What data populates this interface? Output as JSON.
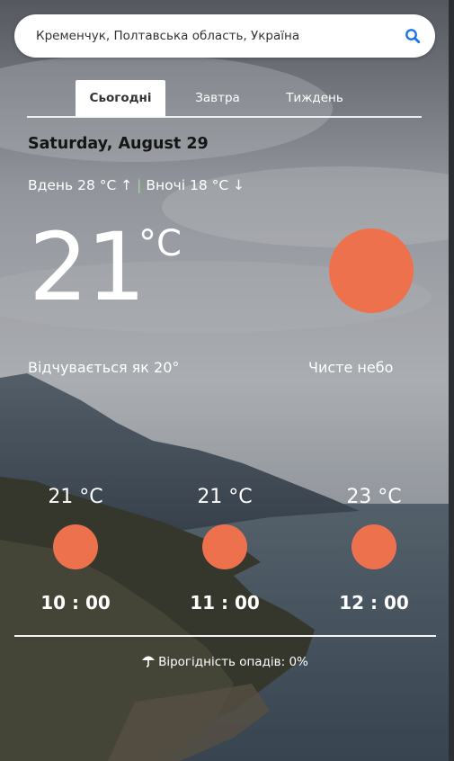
{
  "search": {
    "value": "Кременчук, Полтавська область, Україна",
    "icon": "search-icon"
  },
  "tabs": [
    {
      "label": "Сьогодні",
      "active": true
    },
    {
      "label": "Завтра",
      "active": false
    },
    {
      "label": "Тиждень",
      "active": false
    }
  ],
  "current": {
    "date": "Saturday, August 29",
    "day_label": "Вдень 28 °C ↑",
    "night_label": "Вночі 18 °C ↓",
    "temp": "21",
    "unit": "°C",
    "feels_like": "Відчувається як 20°",
    "condition": "Чисте небо",
    "condition_icon": "sun-icon"
  },
  "hourly": [
    {
      "temp": "21 °C",
      "time": "10 : 00",
      "icon": "sun-icon"
    },
    {
      "temp": "21 °C",
      "time": "11 : 00",
      "icon": "sun-icon"
    },
    {
      "temp": "23 °C",
      "time": "12 : 00",
      "icon": "sun-icon"
    }
  ],
  "precipitation": {
    "text": "Вірогідність опадів: 0%",
    "icon": "umbrella-icon"
  },
  "colors": {
    "sun": "#ee714e",
    "accent": "#1a73e8"
  }
}
